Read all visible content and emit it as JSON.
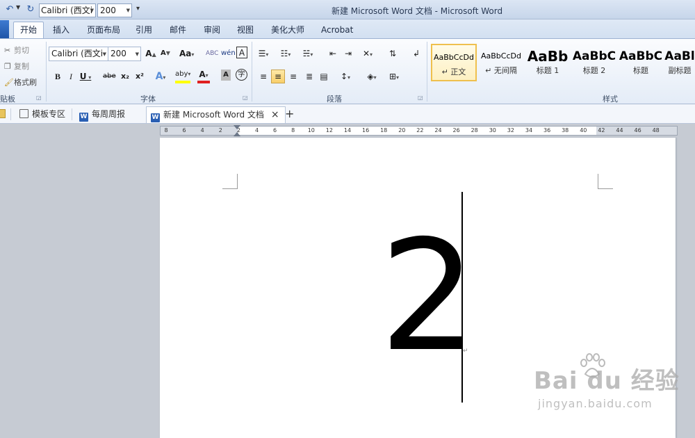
{
  "quick_access": {
    "font_name": "Calibri (西文i",
    "font_size": "200"
  },
  "window": {
    "title": "新建 Microsoft Word 文档 - Microsoft Word"
  },
  "tabs": [
    "开始",
    "插入",
    "页面布局",
    "引用",
    "邮件",
    "审阅",
    "视图",
    "美化大师",
    "Acrobat"
  ],
  "clipboard": {
    "cut": "剪切",
    "copy": "复制",
    "format_painter": "格式刷",
    "label": "贴板"
  },
  "font_group": {
    "font_name": "Calibri (西文i",
    "font_size": "200",
    "grow": "A",
    "shrink": "A",
    "change_case": "Aa",
    "clear_format": "ABC",
    "phonetic": "wén",
    "char_border": "A",
    "bold": "B",
    "italic": "I",
    "underline": "U",
    "strike": "abe",
    "subscript": "x₂",
    "superscript": "x²",
    "text_effect": "A",
    "highlight": "aby",
    "font_color": "A",
    "char_shading": "A",
    "enclose": "字",
    "label": "字体"
  },
  "paragraph_group": {
    "label": "段落"
  },
  "styles_group": {
    "label": "样式",
    "items": [
      {
        "sample": "AaBbCcDd",
        "name": "↵ 正文"
      },
      {
        "sample": "AaBbCcDd",
        "name": "↵ 无间隔"
      },
      {
        "sample": "AaBb",
        "name": "标题 1"
      },
      {
        "sample": "AaBbC",
        "name": "标题 2"
      },
      {
        "sample": "AaBbC",
        "name": "标题"
      },
      {
        "sample": "AaBl",
        "name": "副标题"
      }
    ]
  },
  "doc_tabs": {
    "template": "模板专区",
    "weekly": "每周周报",
    "current": "新建 Microsoft Word 文档",
    "close": "×",
    "new": "+"
  },
  "ruler": [
    "8",
    "6",
    "4",
    "2",
    "2",
    "4",
    "6",
    "8",
    "10",
    "12",
    "14",
    "16",
    "18",
    "20",
    "22",
    "24",
    "26",
    "28",
    "30",
    "32",
    "34",
    "36",
    "38",
    "40",
    "42",
    "44",
    "46",
    "48"
  ],
  "document": {
    "content": "2",
    "paragraph_mark": "↵"
  },
  "watermark": {
    "main": "Bai du 经验",
    "sub": "jingyan.baidu.com"
  },
  "colors": {
    "accent_blue": "#2a5fb3",
    "selected_style": "#efc04d",
    "highlight_yellow": "#ffff00",
    "font_color_red": "#e02020"
  }
}
